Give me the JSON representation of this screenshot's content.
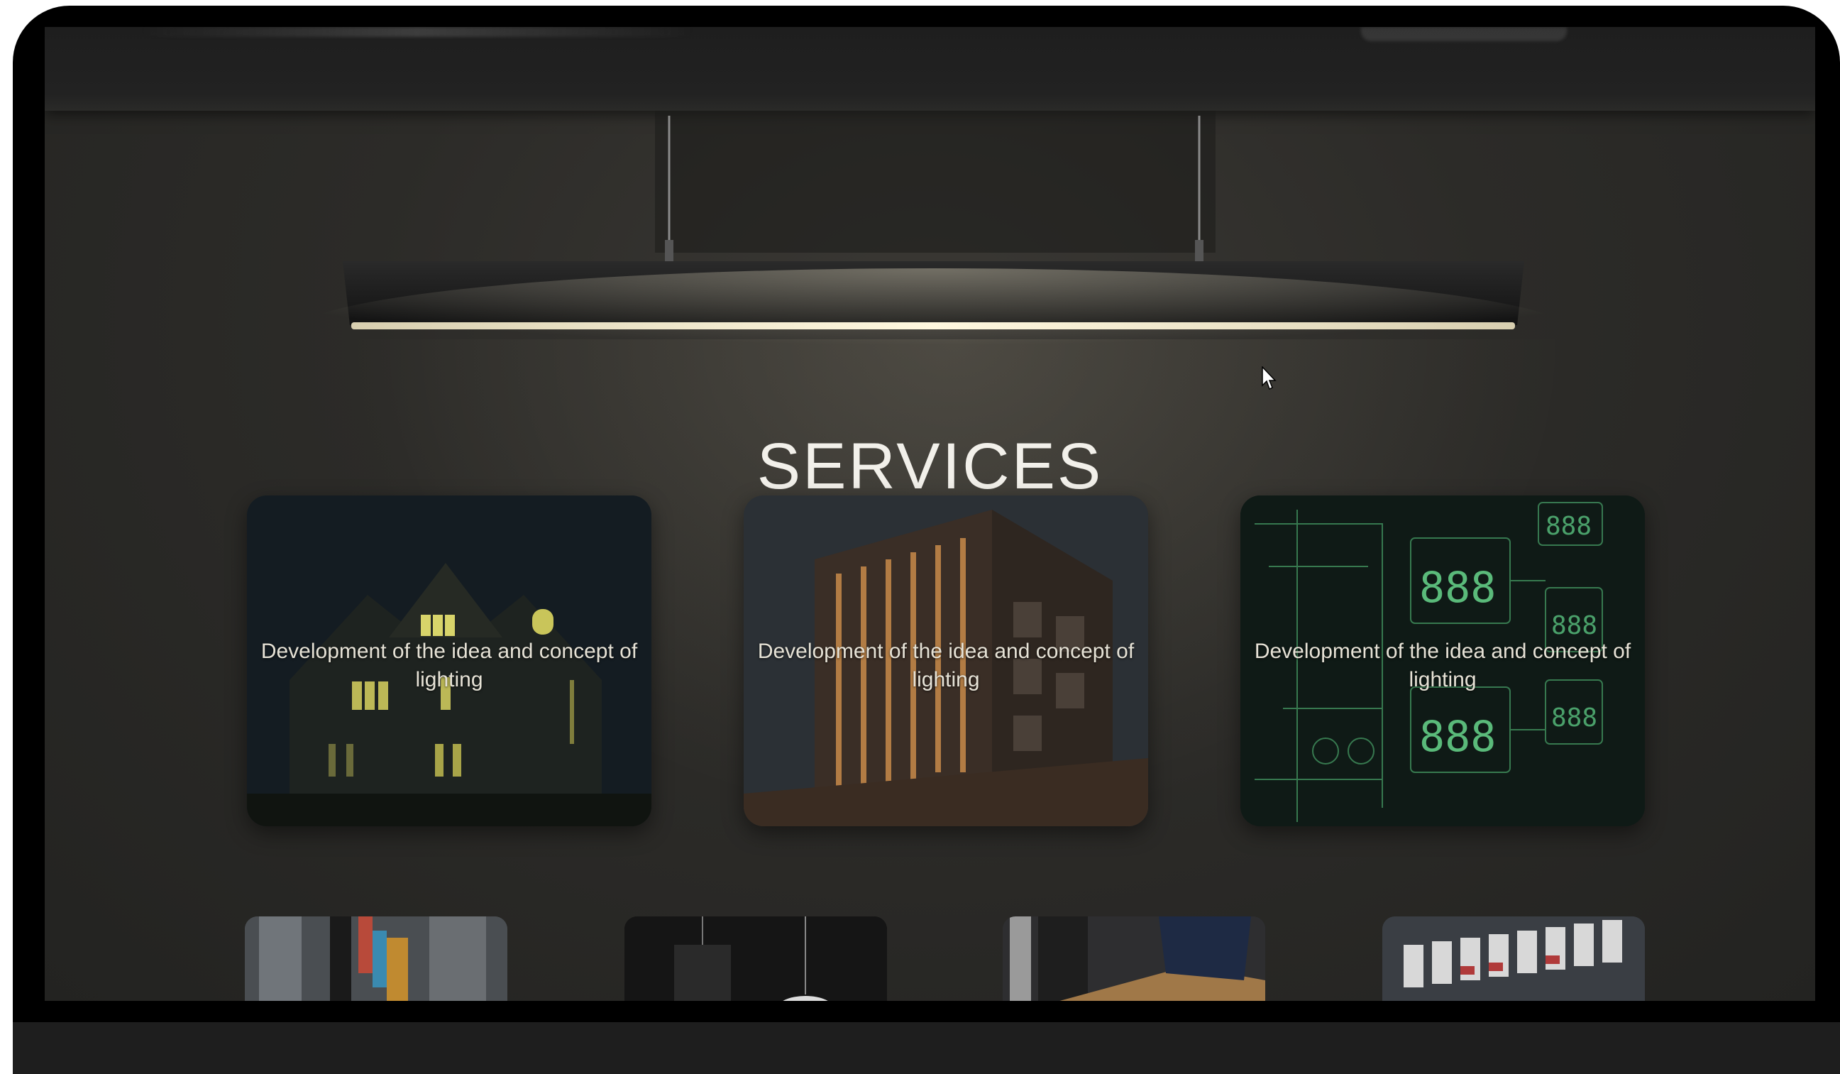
{
  "page": {
    "title": "SERVICES"
  },
  "services": [
    {
      "text": "Development of the idea and concept of lighting",
      "image": "night-house-photo"
    },
    {
      "text": "Development of the idea and concept of lighting",
      "image": "lit-building-facade-photo"
    },
    {
      "text": "Development of the idea and concept of lighting",
      "image": "circuit-schematic-photo"
    }
  ],
  "more_services": [
    {
      "image": "electrical-panel-photo"
    },
    {
      "image": "pendant-lamp-photo"
    },
    {
      "image": "installer-at-work-photo"
    },
    {
      "image": "circuit-breakers-photo"
    }
  ],
  "colors": {
    "background": "#2c2b28",
    "title": "#f2f0ea",
    "lamp_glow": "#fff5d8",
    "frame": "#000000"
  }
}
